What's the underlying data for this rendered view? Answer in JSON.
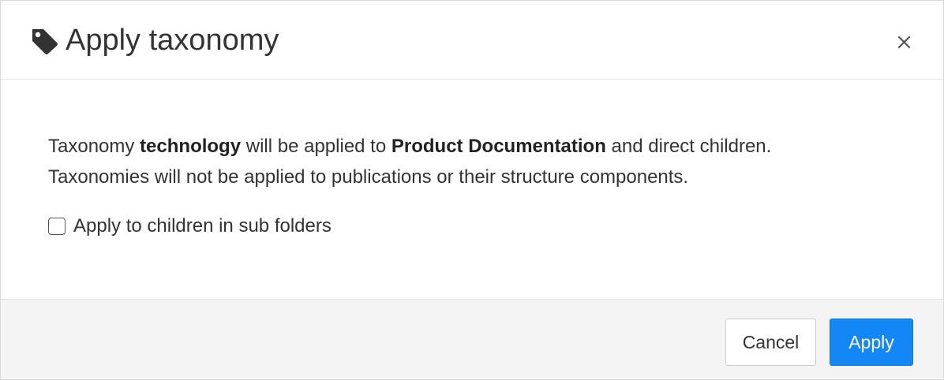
{
  "dialog": {
    "title": "Apply taxonomy",
    "icons": {
      "title_icon": "tag-icon",
      "close_icon": "close-icon"
    }
  },
  "message": {
    "part1": "Taxonomy ",
    "taxonomy_name": "technology",
    "part2": " will be applied to ",
    "target_name": "Product Documentation",
    "part3": " and direct children.",
    "line2": "Taxonomies will not be applied to publications or their structure components."
  },
  "option": {
    "label": "Apply to children in sub folders",
    "checked": false
  },
  "buttons": {
    "cancel_label": "Cancel",
    "apply_label": "Apply"
  },
  "colors": {
    "primary": "#1387f5",
    "footer_bg": "#f4f4f4"
  }
}
